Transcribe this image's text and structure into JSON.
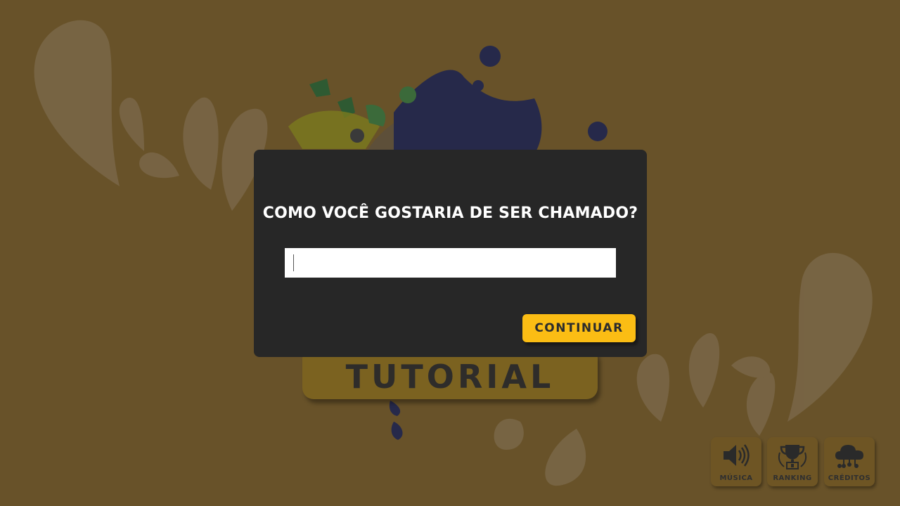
{
  "modal": {
    "title": "COMO VOCÊ GOSTARIA DE SER CHAMADO?",
    "input_value": "",
    "input_placeholder": "",
    "continue_label": "CONTINUAR"
  },
  "background_button": {
    "label": "TUTORIAL"
  },
  "corner_buttons": [
    {
      "label": "MÚSICA",
      "icon": "speaker-icon"
    },
    {
      "label": "RANKING",
      "icon": "trophy-icon"
    },
    {
      "label": "CRÉDITOS",
      "icon": "cloud-network-icon"
    }
  ],
  "colors": {
    "background": "#685229",
    "modal": "#272727",
    "accent": "#fbbd14",
    "text_light": "#ffffff",
    "text_dark": "#2c2c2c"
  }
}
